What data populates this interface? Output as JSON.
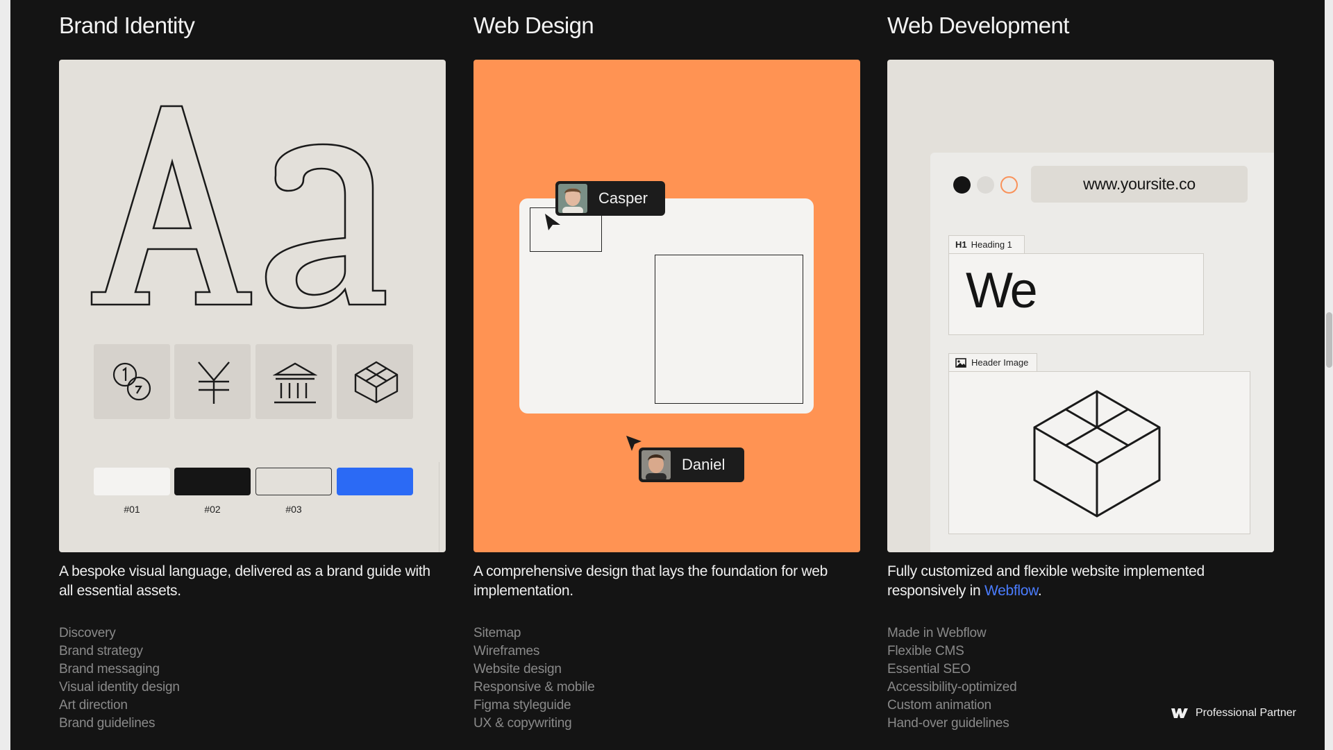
{
  "services": [
    {
      "title": "Brand Identity",
      "description": "A bespoke visual language, delivered as a brand guide with all essential assets.",
      "features": [
        "Discovery",
        "Brand strategy",
        "Brand messaging",
        "Visual identity design",
        "Art direction",
        "Brand guidelines"
      ],
      "swatches": [
        {
          "label": "#01",
          "color": "#f4f3f1"
        },
        {
          "label": "#02",
          "color": "#151515"
        },
        {
          "label": "#03",
          "color": "#e3e0da"
        },
        {
          "label": "",
          "color": "#2b6af5"
        }
      ],
      "icons": [
        "coin-exchange-icon",
        "yen-icon",
        "bank-icon",
        "cube-icon"
      ]
    },
    {
      "title": "Web Design",
      "description": "A comprehensive design that lays the foundation for web implementation.",
      "features": [
        "Sitemap",
        "Wireframes",
        "Website design",
        "Responsive & mobile",
        "Figma styleguide",
        "UX & copywriting"
      ],
      "collaborators": [
        "Casper",
        "Daniel"
      ],
      "accent": "#ff9353"
    },
    {
      "title": "Web Development",
      "description_before": "Fully customized and flexible website implemented responsively in ",
      "description_link": "Webflow",
      "description_after": ".",
      "features": [
        "Made in Webflow",
        "Flexible CMS",
        "Essential SEO",
        "Accessibility-optimized",
        "Custom animation",
        "Hand-over guidelines"
      ],
      "mockup": {
        "url": "www.yoursite.co",
        "h1_tag": "H1",
        "h1_label": "Heading 1",
        "heading_text": "We",
        "image_label": "Header Image"
      }
    }
  ],
  "partner": {
    "label": "Professional Partner",
    "icon": "webflow-logo-icon"
  },
  "colors": {
    "background": "#141414",
    "card": "#e3e0da",
    "accent": "#ff9353",
    "link": "#4a7cff"
  }
}
